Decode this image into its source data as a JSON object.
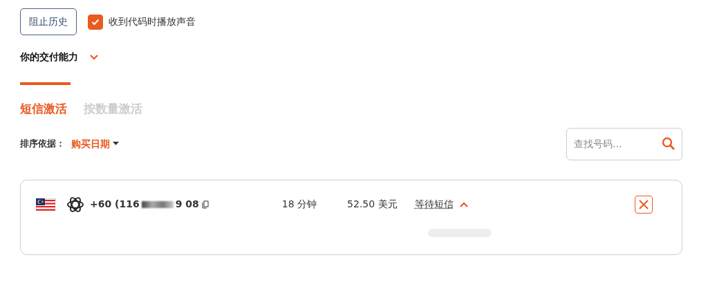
{
  "block_history_button": "阻止历史",
  "sound_option": {
    "label": "收到代码时播放声音",
    "checked": true
  },
  "delivery_section": {
    "title": "你的交付能力",
    "expanded": false
  },
  "tabs": [
    {
      "label": "短信激活",
      "selected": true
    },
    {
      "label": "按数量激活",
      "selected": false
    }
  ],
  "sort": {
    "label": "排序依据：",
    "value": "购买日期"
  },
  "search": {
    "placeholder": "查找号码..."
  },
  "activations": [
    {
      "phone_start": "+60 (116",
      "phone_end": "9 08",
      "duration": "18 分钟",
      "price": "52.50 美元",
      "status": "等待短信",
      "expanded": true
    }
  ]
}
